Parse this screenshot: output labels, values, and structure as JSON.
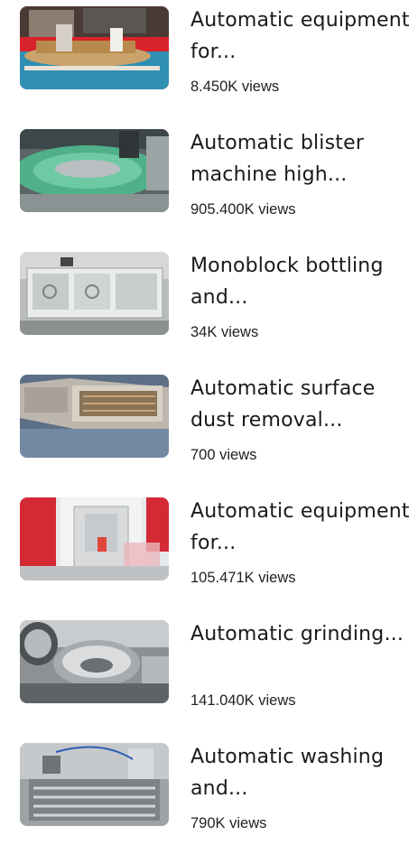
{
  "videos": [
    {
      "title": "Automatic equipment for...",
      "views": "8.450K views"
    },
    {
      "title": "Automatic blister machine high...",
      "views": "905.400K views"
    },
    {
      "title": "Monoblock bottling and...",
      "views": "34K views"
    },
    {
      "title": "Automatic surface dust removal...",
      "views": "700 views"
    },
    {
      "title": "Automatic equipment for...",
      "views": "105.471K views"
    },
    {
      "title": "Automatic grinding...",
      "views": "141.040K views"
    },
    {
      "title": "Automatic washing and...",
      "views": "790K views"
    }
  ]
}
